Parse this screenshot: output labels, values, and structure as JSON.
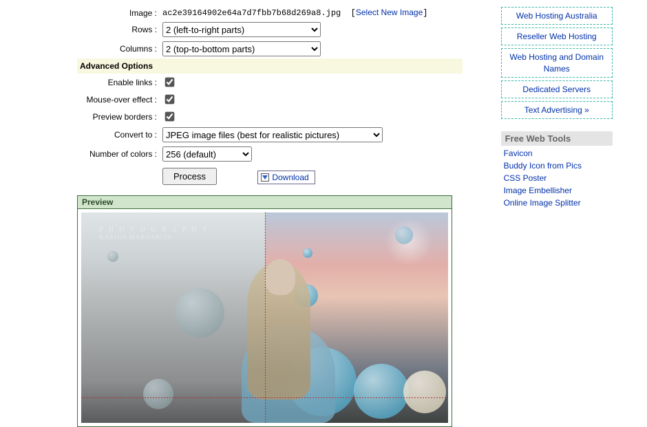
{
  "form": {
    "image_label": "Image :",
    "image_filename": "ac2e39164902e64a7d7fbb7b68d269a8.jpg",
    "select_new_image": "Select New Image",
    "rows_label": "Rows :",
    "rows_value": "2 (left-to-right parts)",
    "cols_label": "Columns :",
    "cols_value": "2 (top-to-bottom parts)",
    "advanced_heading": "Advanced Options",
    "enable_links_label": "Enable links :",
    "mouseover_label": "Mouse-over effect :",
    "preview_borders_label": "Preview borders :",
    "convert_label": "Convert to :",
    "convert_value": "JPEG image files (best for realistic pictures)",
    "colors_label": "Number of colors :",
    "colors_value": "256 (default)",
    "process_btn": "Process",
    "download_label": "Download"
  },
  "preview": {
    "title": "Preview",
    "watermark_line1": "P H O T O G R A P H Y",
    "watermark_line2": "KARINA MARGARITA"
  },
  "sidebar": {
    "nav": [
      "Web Hosting Australia",
      "Reseller Web Hosting",
      "Web Hosting and Domain Names",
      "Dedicated Servers",
      "Text Advertising »"
    ],
    "tools_heading": "Free Web Tools",
    "tools": [
      "Favicon",
      "Buddy Icon from Pics",
      "CSS Poster",
      "Image Embellisher",
      "Online Image Splitter"
    ]
  }
}
